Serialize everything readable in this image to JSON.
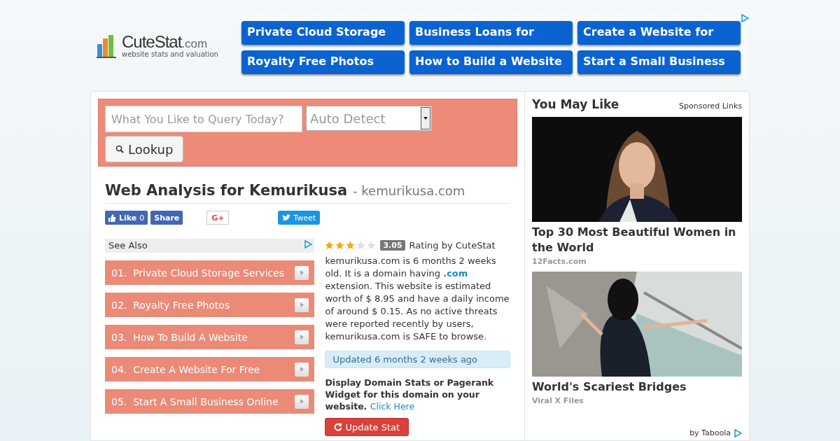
{
  "logo": {
    "name": "CuteStat",
    "tld": ".com",
    "tagline": "website stats and valuation"
  },
  "ad_links": [
    "Private Cloud Storage",
    "Business Loans for",
    "Create a Website for",
    "Royalty Free Photos",
    "How to Build a Website",
    "Start a Small Business"
  ],
  "search": {
    "placeholder": "What You Like to Query Today?",
    "select_value": "Auto Detect",
    "button": "Lookup"
  },
  "heading": {
    "title": "Web Analysis for Kemurikusa",
    "domain": "- kemurikusa.com"
  },
  "social": {
    "like": "Like",
    "like_count": "0",
    "share": "Share",
    "gplus": "G+",
    "tweet": "Tweet"
  },
  "see_also": {
    "title": "See Also",
    "items": [
      {
        "number": "01.",
        "label": "Private Cloud Storage Services"
      },
      {
        "number": "02.",
        "label": "Royalty Free Photos"
      },
      {
        "number": "03.",
        "label": "How To Build A Website"
      },
      {
        "number": "04.",
        "label": "Create A Website For Free"
      },
      {
        "number": "05.",
        "label": "Start A Small Business Online"
      }
    ]
  },
  "rating": {
    "stars": 3,
    "score": "3.05",
    "label": "Rating by CuteStat"
  },
  "summary": "kemurikusa.com is 6 months 2 weeks old. It is a domain having **.com** extension. This website is estimated worth of $ 8.95 and have a daily income of around $ 0.15. As no active threats were reported recently by users, kemurikusa.com is SAFE to browse.",
  "updated": "Updated 6 months 2 weeks ago",
  "widget": {
    "text": "Display Domain Stats or Pagerank Widget for this domain on your website.",
    "link": "Click Here"
  },
  "update_button": "Update Stat",
  "sidebar": {
    "title": "You May Like",
    "sponsored": "Sponsored Links",
    "footer": "by Taboola",
    "items": [
      {
        "kind": "portrait",
        "title": "Top 30 Most Beautiful Women in the World",
        "source": "12Facts.com"
      },
      {
        "kind": "bridge",
        "title": "World's Scariest Bridges",
        "source": "Viral X Files"
      }
    ]
  }
}
